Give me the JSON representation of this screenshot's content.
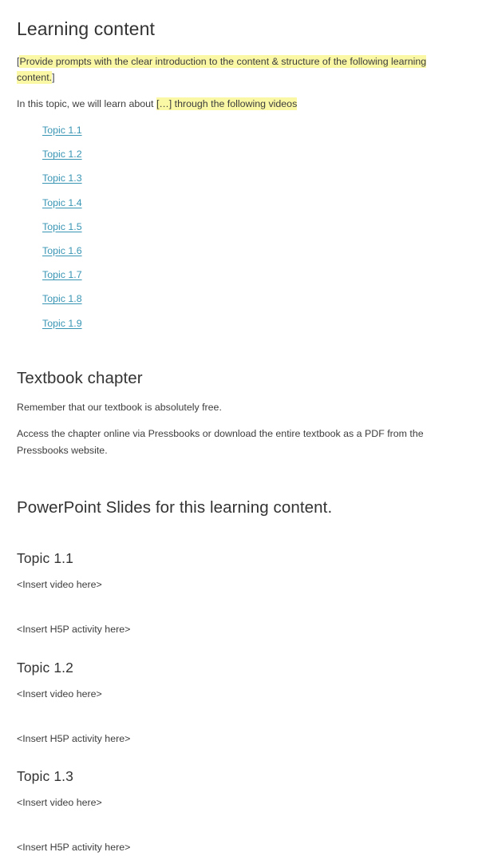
{
  "document": {
    "sections": [
      {
        "id": "learning-content",
        "heading": "Learning content",
        "prompt_open_bracket": "[",
        "prompt_highlighted": "Provide prompts with the clear introduction to the content & structure of the following learning content.",
        "prompt_close_bracket": "]",
        "intro_prefix": "In this topic, we will learn about ",
        "intro_highlighted": "[…] through the following videos",
        "topic_links": [
          "Topic 1.1",
          "Topic 1.2",
          "Topic 1.3",
          "Topic 1.4",
          "Topic 1.5",
          "Topic 1.6",
          "Topic 1.7",
          "Topic 1.8",
          "Topic 1.9"
        ]
      },
      {
        "id": "textbook-chapter",
        "heading": "Textbook chapter",
        "paragraph_1": "Remember that our textbook is absolutely free.",
        "paragraph_2": "Access the chapter online via Pressbooks or download the entire textbook as a PDF from the Pressbooks website."
      },
      {
        "id": "powerpoint-slides",
        "heading": "PowerPoint Slides for this learning content."
      }
    ],
    "topic_sections": [
      {
        "heading": "Topic 1.1",
        "video_placeholder": "<Insert video here>",
        "h5p_placeholder": "<Insert H5P activity here>"
      },
      {
        "heading": "Topic 1.2",
        "video_placeholder": "<Insert video here>",
        "h5p_placeholder": "<Insert H5P activity here>"
      },
      {
        "heading": "Topic 1.3",
        "video_placeholder": "<Insert video here>",
        "h5p_placeholder": "<Insert H5P activity here>"
      }
    ],
    "colors": {
      "highlight": "#fbf8a5",
      "link": "#3995b4",
      "heading": "#333333",
      "body": "#3d3d3d",
      "background": "#ffffff"
    }
  }
}
